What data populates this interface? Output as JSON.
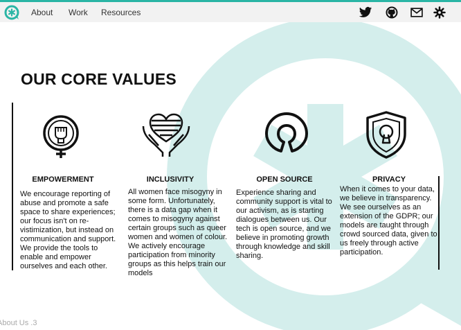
{
  "theme": {
    "accent": "#2ab5a5",
    "watermark": "#d4eeec",
    "text": "#111111"
  },
  "nav": {
    "logo_icon": "speech-bubble-asterisk-icon",
    "items": [
      {
        "label": "About"
      },
      {
        "label": "Work"
      },
      {
        "label": "Resources"
      }
    ],
    "social": [
      {
        "icon": "twitter-icon"
      },
      {
        "icon": "github-icon"
      },
      {
        "icon": "mail-icon"
      },
      {
        "icon": "settings-gear-icon"
      }
    ]
  },
  "main": {
    "heading": "OUR CORE VALUES",
    "values": [
      {
        "icon": "female-fist-icon",
        "title": "EMPOWERMENT",
        "text": "We encourage reporting of abuse and promote a safe space to share experiences; our focus isn't on re-vistimization, but instead on communication and support. We provide the tools to enable and empower ourselves and each other."
      },
      {
        "icon": "heart-hands-icon",
        "title": "INCLUSIVITY",
        "text": "All women face misogyny in some form. Unfortunately, there is a data gap when it comes to misogyny against certain groups such as queer women and women of colour. We actively encourage participation from minority groups as this helps train our models"
      },
      {
        "icon": "open-source-icon",
        "title": "OPEN SOURCE",
        "text": "Experience sharing and community support is vital to our activism, as is starting dialogues between us. Our tech is open source, and we believe in promoting growth through knowledge and skill sharing."
      },
      {
        "icon": "shield-keyhole-icon",
        "title": "PRIVACY",
        "text": "When it comes to your data, we believe in transparency. We see ourselves as an extension of the GDPR; our models are taught through crowd sourced data, given to us freely through active participation."
      }
    ]
  },
  "footer": {
    "text": "About Us .3"
  }
}
